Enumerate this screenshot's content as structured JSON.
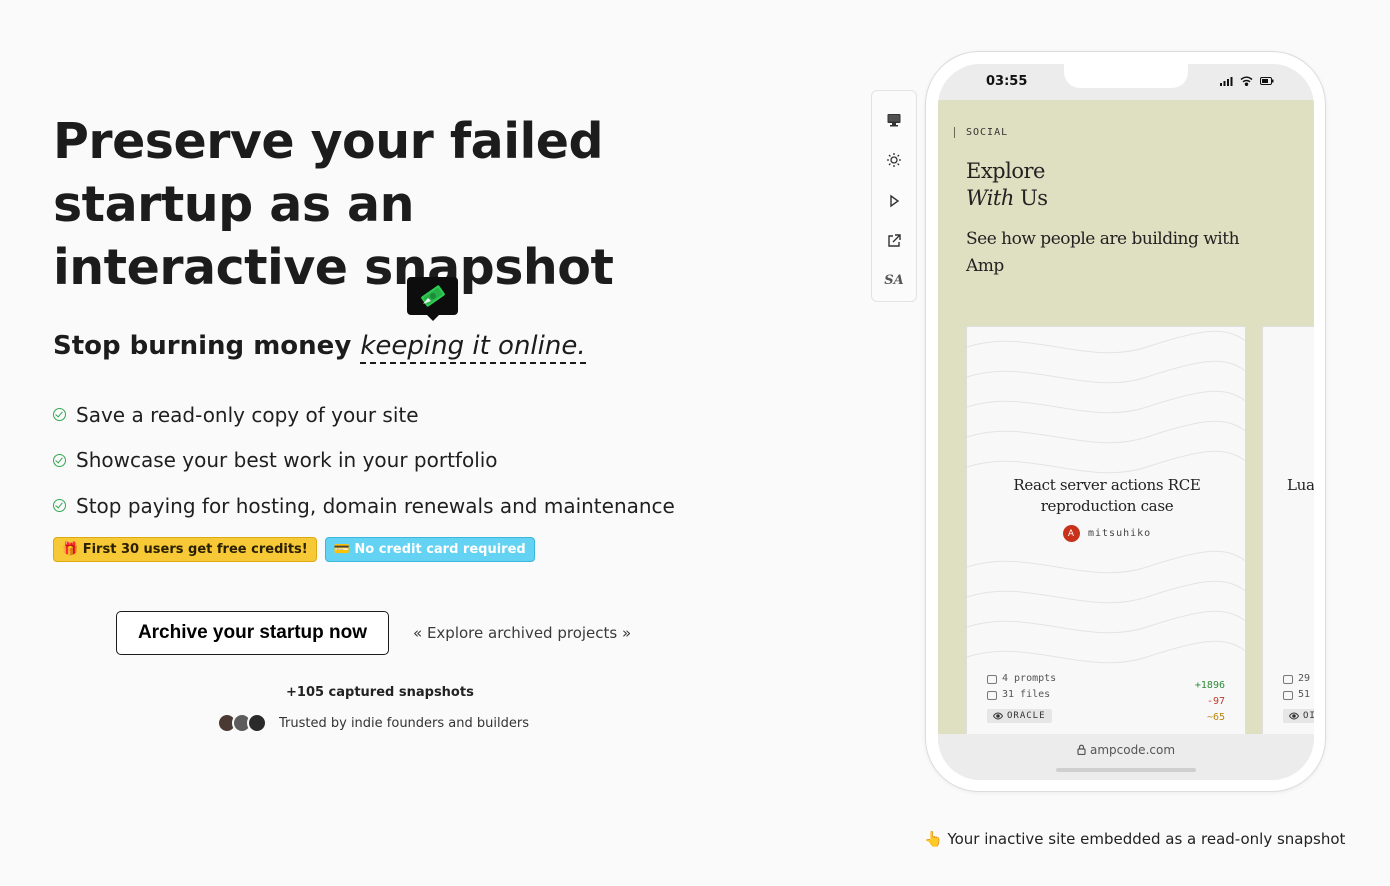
{
  "hero": {
    "title": "Preserve your failed startup as an interactive snapshot",
    "subtitle_main": "Stop burning money",
    "subtitle_emphasis": "keeping it online."
  },
  "features": [
    {
      "text": "Save a read-only copy of your site"
    },
    {
      "text": "Showcase your best work in your portfolio"
    },
    {
      "text": "Stop paying for hosting, domain renewals and maintenance"
    }
  ],
  "badges": {
    "free_credits": "🎁 First 30 users get free credits!",
    "no_card": "💳 No credit card required"
  },
  "cta": {
    "primary_label": "Archive your startup now",
    "secondary_label": "« Explore archived projects »"
  },
  "social_proof": {
    "snapshots_count": "+105 captured snapshots",
    "trusted_text": "Trusted by indie founders and builders"
  },
  "toolbar": {
    "icons": [
      "desktop-icon",
      "sun-icon",
      "play-icon",
      "external-link-icon",
      "sa-icon"
    ],
    "sa_label": "SA"
  },
  "phone": {
    "time": "03:55",
    "section_label": "SOCIAL",
    "title_line1": "Explore",
    "title_with": "With",
    "title_us": " Us",
    "subtitle": "See how people are building with Amp",
    "cards": [
      {
        "title": "React server actions RCE reproduction case",
        "author_initial": "A",
        "author": "mitsuhiko",
        "prompts": "4 prompts",
        "files": "31 files",
        "added": "+1896",
        "removed": "-97",
        "modified": "~65",
        "tag": "ORACLE"
      },
      {
        "title": "Lua",
        "prompts": "29",
        "files": "51",
        "tag": "OI"
      }
    ],
    "url": "ampcode.com"
  },
  "caption": "👆 Your inactive site embedded as a read-only snapshot"
}
